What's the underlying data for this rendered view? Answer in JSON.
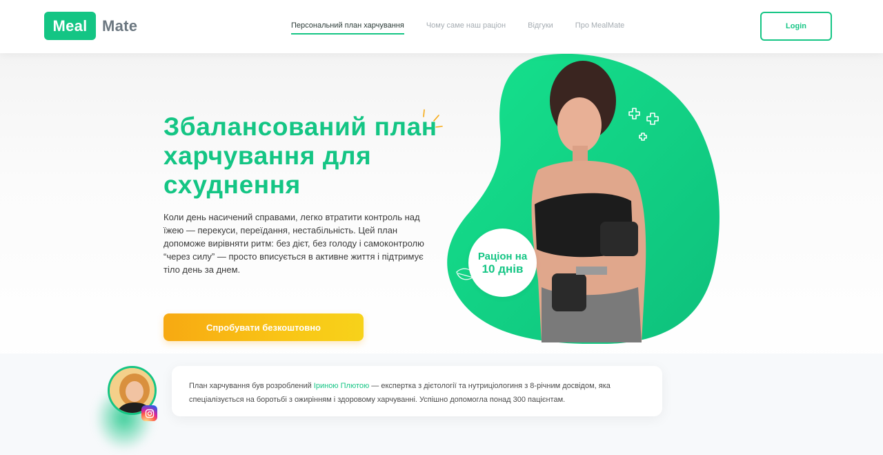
{
  "header": {
    "logo_box": "Meal",
    "logo_text": "Mate",
    "nav": [
      {
        "label": "Персональний план харчування",
        "active": true
      },
      {
        "label": "Чому саме наш раціон",
        "active": false
      },
      {
        "label": "Відгуки",
        "active": false
      },
      {
        "label": "Про MealMate",
        "active": false
      }
    ],
    "login_label": "Login"
  },
  "hero": {
    "title": "Збалансований план харчування для схуднення",
    "description": "Коли день насичений справами, легко втратити контроль над їжею — перекуси, переїдання, нестабільність.  Цей план допоможе вирівняти ритм: без дієт, без голоду і самоконтролю “через силу” — просто вписується в активне життя і підтримує тіло день за днем.",
    "cta_label": "Спробувати безкоштовно",
    "badge_line1": "Раціон на",
    "badge_line2": "10 днів"
  },
  "author": {
    "text_before": "План харчування був розроблений ",
    "name": "Іриною Плютою",
    "text_after": " — експертка з дієтології та нутриціологиня з 8-річним досвідом, яка спеціалізується на боротьбі з ожирінням і здоровому харчуванні. Успішно допомогла понад 300 пацієнтам."
  },
  "colors": {
    "accent": "#14c584",
    "cta": "#f7b514",
    "text": "#3a3a3a"
  },
  "icons": [
    "instagram-icon",
    "sparkle-icon",
    "plus-decor-icon",
    "leaf-icon"
  ]
}
